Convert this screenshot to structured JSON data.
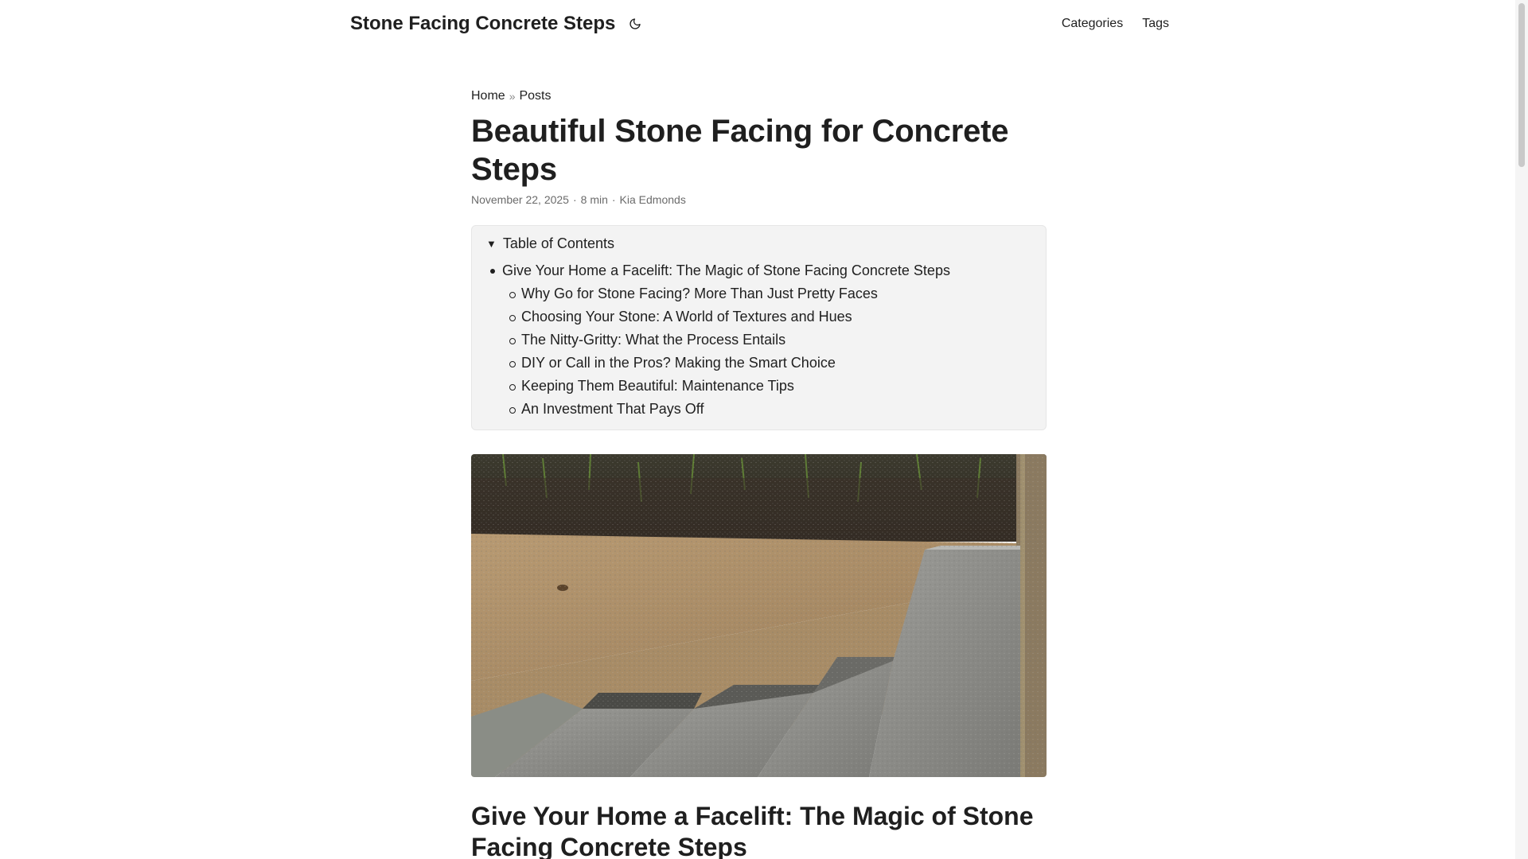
{
  "site": {
    "title": "Stone Facing Concrete Steps",
    "theme_icon": "moon-icon"
  },
  "nav": {
    "items": [
      {
        "label": "Categories"
      },
      {
        "label": "Tags"
      }
    ]
  },
  "breadcrumb": {
    "items": [
      {
        "label": "Home"
      },
      {
        "label": "Posts"
      }
    ],
    "separator": "»"
  },
  "post": {
    "title": "Beautiful Stone Facing for Concrete Steps",
    "date": "November 22, 2025",
    "read_time": "8 min",
    "author": "Kia Edmonds",
    "meta_separator": "·"
  },
  "toc": {
    "summary": "Table of Contents",
    "items": [
      {
        "label": "Give Your Home a Facelift: The Magic of Stone Facing Concrete Steps",
        "children": [
          {
            "label": "Why Go for Stone Facing? More Than Just Pretty Faces"
          },
          {
            "label": "Choosing Your Stone: A World of Textures and Hues"
          },
          {
            "label": "The Nitty-Gritty: What the Process Entails"
          },
          {
            "label": "DIY or Call in the Pros? Making the Smart Choice"
          },
          {
            "label": "Keeping Them Beautiful: Maintenance Tips"
          },
          {
            "label": "An Investment That Pays Off"
          }
        ]
      }
    ]
  },
  "cover": {
    "subject": "concrete steps inside wooden forms"
  },
  "content": {
    "heading": "Give Your Home a Facelift: The Magic of Stone Facing Concrete Steps"
  }
}
